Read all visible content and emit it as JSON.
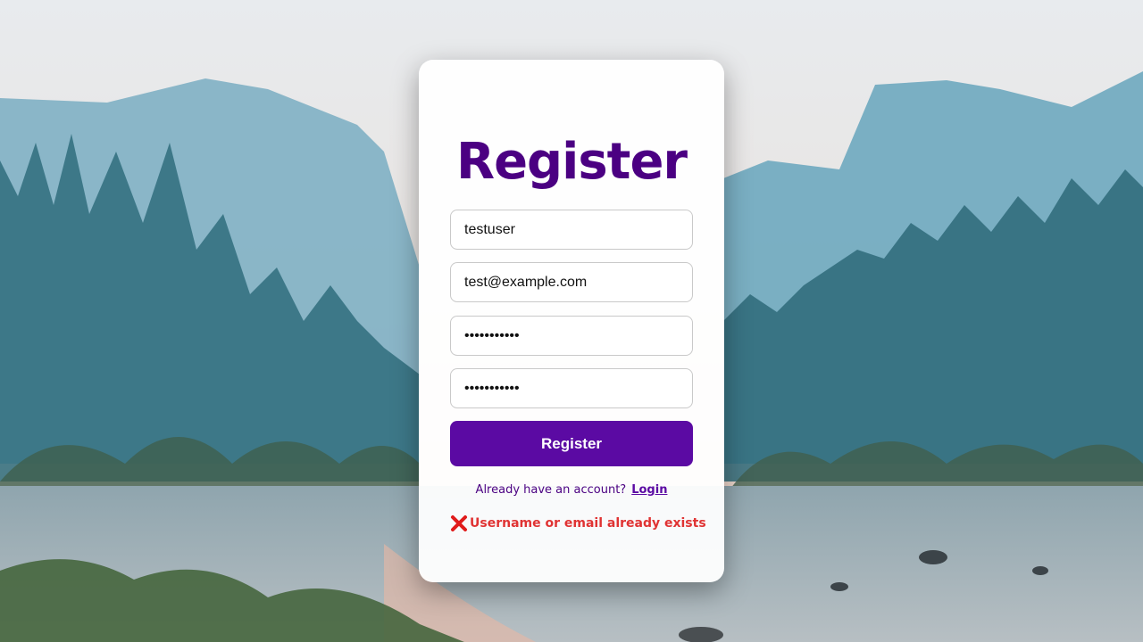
{
  "form": {
    "title": "Register",
    "username_value": "testuser",
    "email_value": "test@example.com",
    "password_value": "•••••••••••",
    "confirm_password_value": "•••••••••••",
    "submit_label": "Register",
    "login_prompt": "Already have an account?",
    "login_link": "Login",
    "error_message": "Username or email already exists"
  },
  "colors": {
    "accent": "#5b0aa3",
    "title": "#4b0082",
    "error": "#e03333"
  },
  "icons": {
    "error": "close-x-icon"
  }
}
